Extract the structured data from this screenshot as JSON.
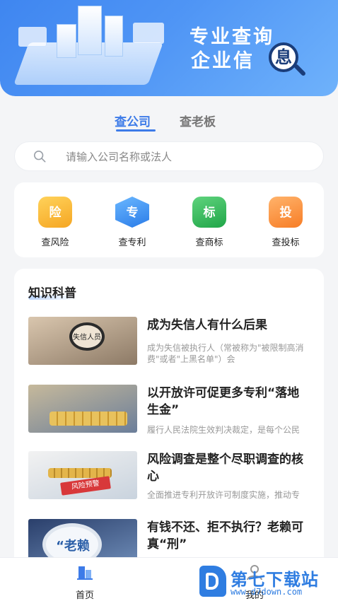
{
  "banner": {
    "line1": "专业查询",
    "line2_prefix": "企业信",
    "line2_highlight": "息"
  },
  "tabs": [
    {
      "label": "查公司",
      "active": true
    },
    {
      "label": "查老板",
      "active": false
    }
  ],
  "search": {
    "placeholder": "请输入公司名称或法人",
    "value": ""
  },
  "quick_actions": [
    {
      "icon_char": "险",
      "label": "查风险",
      "color": "#f5a623",
      "icon": "shield-icon"
    },
    {
      "icon_char": "专",
      "label": "查专利",
      "color": "#2b7ce8",
      "icon": "hexagon-icon"
    },
    {
      "icon_char": "标",
      "label": "查商标",
      "color": "#20a648",
      "icon": "circle-icon"
    },
    {
      "icon_char": "投",
      "label": "查投标",
      "color": "#f77d26",
      "icon": "square-icon"
    }
  ],
  "knowledge": {
    "title": "知识科普",
    "articles": [
      {
        "title": "成为失信人有什么后果",
        "desc": "成为失信被执行人（常被称为\"被限制高消费\"或者\"上黑名单\"）会",
        "thumb_text": "失信人员"
      },
      {
        "title": "以开放许可促更多专利“落地生金”",
        "desc": "履行人民法院生效判决裁定，是每个公民应尽的义务"
      },
      {
        "title": "风险调查是整个尽职调查的核心",
        "desc": "全面推进专利开放许可制度实施，推动专利转化运用",
        "thumb_text": "风险预警"
      },
      {
        "title": "有钱不还、拒不执行？老赖可真“刑”",
        "desc": "",
        "thumb_text": "“老赖"
      }
    ]
  },
  "bottom_nav": [
    {
      "label": "首页",
      "active": true,
      "icon": "building-icon"
    },
    {
      "label": "我的",
      "active": false,
      "icon": "user-icon"
    }
  ],
  "watermark": {
    "text": "第七下载站",
    "url": "www.d7down.com"
  },
  "colors": {
    "accent": "#3d7be8",
    "banner": "#4f95f5"
  }
}
